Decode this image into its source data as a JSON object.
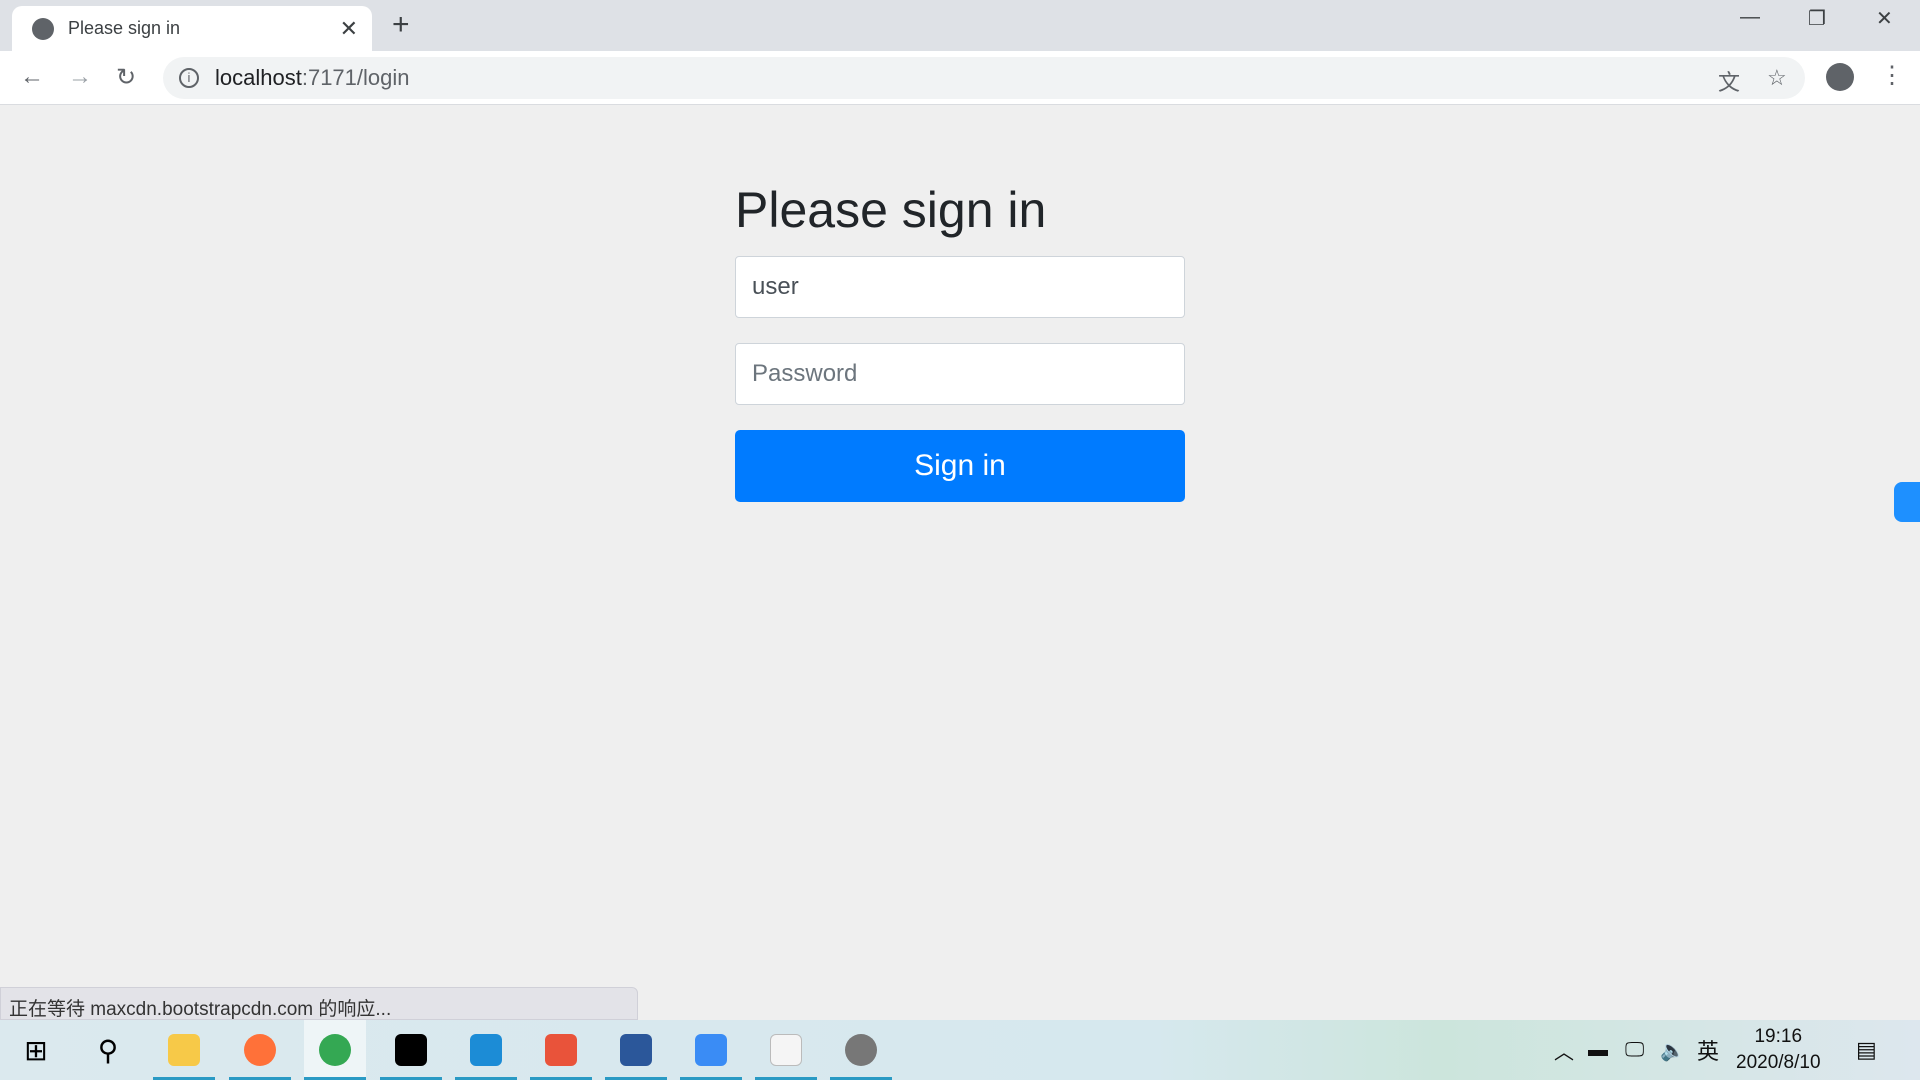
{
  "browser": {
    "tab_title": "Please sign in",
    "url_host": "localhost",
    "url_path": ":7171/login"
  },
  "form": {
    "heading": "Please sign in",
    "username_value": "user",
    "password_placeholder": "Password",
    "submit_label": "Sign in"
  },
  "status_text": "正在等待 maxcdn.bootstrapcdn.com 的响应...",
  "taskbar": {
    "apps": [
      {
        "name": "file-explorer",
        "color": "#f7c948"
      },
      {
        "name": "firefox",
        "color": "#ff7139"
      },
      {
        "name": "chrome",
        "color": "#34a853",
        "active": true
      },
      {
        "name": "intellij-idea",
        "color": "#000000"
      },
      {
        "name": "virtualbox",
        "color": "#1c8cd6"
      },
      {
        "name": "app-swirl",
        "color": "#e9533a"
      },
      {
        "name": "word",
        "color": "#2b579a"
      },
      {
        "name": "baidu-netdisk",
        "color": "#3a8cf5"
      },
      {
        "name": "typora",
        "color": "#f5f5f5"
      },
      {
        "name": "avatar-app",
        "color": "#777777"
      }
    ],
    "ime": "英",
    "time": "19:16",
    "date": "2020/8/10"
  },
  "colors": {
    "accent": "#007bff"
  }
}
